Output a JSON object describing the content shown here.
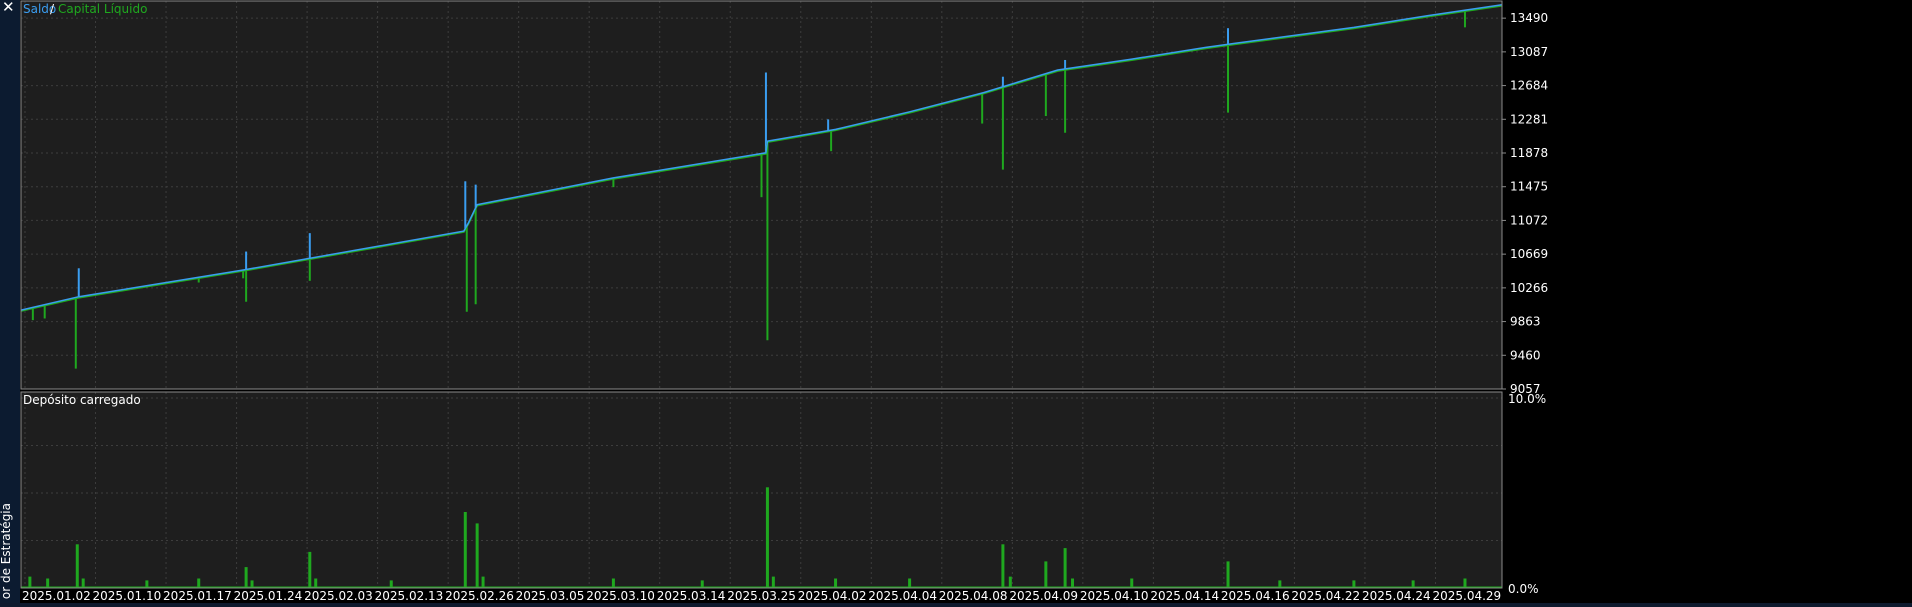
{
  "panel": {
    "close_glyph": "✕",
    "side_tab_label": "or de Estratégia"
  },
  "colors": {
    "background": "#1e1e1e",
    "grid": "#3d3d3d",
    "border": "#8a8a8a",
    "text": "#ffffff",
    "balance": "#3a9df0",
    "equity": "#1fa81f"
  },
  "chart_data": [
    {
      "type": "line",
      "legend": [
        "Saldo",
        "Capital Líquido"
      ],
      "legend_separator": "/",
      "yticks": [
        9057,
        9460,
        9863,
        10266,
        10669,
        11072,
        11475,
        11878,
        12281,
        12684,
        13087,
        13490
      ],
      "ylim": [
        9057,
        13695
      ],
      "xlim": [
        0,
        100
      ],
      "grid": true,
      "series": [
        {
          "name": "Saldo",
          "color": "#3a9df0",
          "x": [
            0,
            3.9,
            15,
            29.9,
            30.2,
            30.8,
            40,
            50.3,
            50.4,
            55,
            60,
            65,
            70,
            75,
            80,
            82,
            90,
            95,
            100
          ],
          "y": [
            10000,
            10160,
            10480,
            10945,
            11040,
            11260,
            11580,
            11880,
            12020,
            12160,
            12370,
            12600,
            12870,
            13000,
            13140,
            13190,
            13380,
            13520,
            13650
          ]
        },
        {
          "name": "Capital Líquido",
          "color": "#1fa81f",
          "x": [
            0,
            3.9,
            15,
            29.9,
            30.2,
            30.8,
            40,
            50.3,
            50.4,
            55,
            60,
            65,
            70,
            75,
            80,
            82,
            90,
            95,
            100
          ],
          "y": [
            9990,
            10150,
            10470,
            10935,
            11030,
            11250,
            11570,
            11870,
            12010,
            12150,
            12360,
            12590,
            12860,
            12990,
            13130,
            13180,
            13370,
            13510,
            13640
          ]
        }
      ],
      "equity_dips": [
        {
          "x": 0.8,
          "y": 9880
        },
        {
          "x": 1.6,
          "y": 9900
        },
        {
          "x": 3.7,
          "y": 9300
        },
        {
          "x": 12,
          "y": 10330
        },
        {
          "x": 15,
          "y": 10380
        },
        {
          "x": 15.2,
          "y": 10100
        },
        {
          "x": 19.5,
          "y": 10350
        },
        {
          "x": 30.1,
          "y": 9980
        },
        {
          "x": 30.7,
          "y": 10070
        },
        {
          "x": 40,
          "y": 11470
        },
        {
          "x": 50,
          "y": 11350
        },
        {
          "x": 50.4,
          "y": 9640
        },
        {
          "x": 54.7,
          "y": 11900
        },
        {
          "x": 64.9,
          "y": 12230
        },
        {
          "x": 66.3,
          "y": 11680
        },
        {
          "x": 69.2,
          "y": 12320
        },
        {
          "x": 70.5,
          "y": 12120
        },
        {
          "x": 81.5,
          "y": 12360
        },
        {
          "x": 97.5,
          "y": 13380
        }
      ],
      "balance_spikes": [
        {
          "x": 3.9,
          "y": 10500
        },
        {
          "x": 15.2,
          "y": 10700
        },
        {
          "x": 19.5,
          "y": 10920
        },
        {
          "x": 30.0,
          "y": 11540
        },
        {
          "x": 30.7,
          "y": 11500
        },
        {
          "x": 50.3,
          "y": 12840
        },
        {
          "x": 54.5,
          "y": 12280
        },
        {
          "x": 66.3,
          "y": 12790
        },
        {
          "x": 69.3,
          "y": 12820
        },
        {
          "x": 70.5,
          "y": 12990
        },
        {
          "x": 81.5,
          "y": 13370
        }
      ]
    },
    {
      "type": "area",
      "title": "Depósito carregado",
      "yticks": [
        "10.0%",
        "0.0%"
      ],
      "ylim": [
        0,
        10
      ],
      "xlim": [
        0,
        100
      ],
      "grid": true,
      "series": [
        {
          "name": "Depósito carregado",
          "color": "#1fa81f",
          "x": [
            0.6,
            1.8,
            3.8,
            4.2,
            8.5,
            12,
            15.2,
            15.6,
            19.5,
            19.9,
            25,
            30.0,
            30.8,
            31.2,
            40,
            46,
            50.4,
            50.8,
            55,
            60,
            66.3,
            66.8,
            69.2,
            70.5,
            71,
            75,
            81.5,
            85,
            90,
            94,
            97.5
          ],
          "y": [
            0.6,
            0.5,
            2.3,
            0.5,
            0.4,
            0.5,
            1.1,
            0.4,
            1.9,
            0.5,
            0.4,
            4.0,
            3.4,
            0.6,
            0.5,
            0.4,
            5.3,
            0.6,
            0.5,
            0.5,
            2.3,
            0.6,
            1.4,
            2.1,
            0.5,
            0.5,
            1.4,
            0.4,
            0.4,
            0.4,
            0.5
          ]
        }
      ]
    }
  ],
  "xaxis": {
    "ticks": [
      "2025.01.02",
      "2025.01.10",
      "2025.01.17",
      "2025.01.24",
      "2025.02.03",
      "2025.02.13",
      "2025.02.26",
      "2025.03.05",
      "2025.03.10",
      "2025.03.14",
      "2025.03.25",
      "2025.04.02",
      "2025.04.04",
      "2025.04.08",
      "2025.04.09",
      "2025.04.10",
      "2025.04.14",
      "2025.04.16",
      "2025.04.22",
      "2025.04.24",
      "2025.04.29"
    ]
  }
}
